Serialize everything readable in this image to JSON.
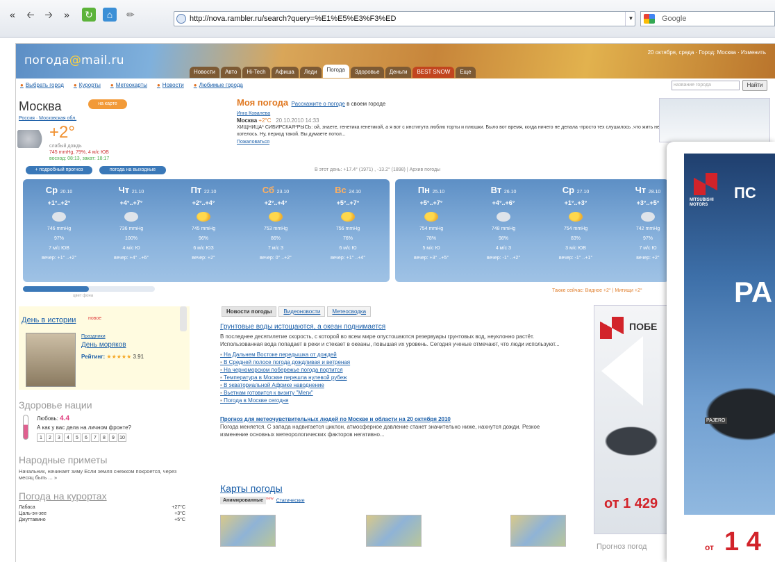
{
  "browser": {
    "url": "http://nova.rambler.ru/search?query=%E1%E5%E3%F3%ED",
    "search_placeholder": "Google"
  },
  "header": {
    "logo_text": "погода",
    "logo_at": "@",
    "logo_domain": "mail.ru",
    "top_right": "20 октября, среда · Город: Москва · Изменить",
    "tabs": [
      "Новости",
      "Авто",
      "Hi-Tech",
      "Афиша",
      "Леди",
      "Погода",
      "Здоровье",
      "Деньги",
      "BEST SNOW",
      "Еще"
    ],
    "active_tab": "Погода"
  },
  "subnav": [
    "Выбрать город",
    "Курорты",
    "Метеокарты",
    "Новости",
    "Любимые города"
  ],
  "city_search": {
    "placeholder": "название города",
    "button": "Найти"
  },
  "city": {
    "name": "Москва",
    "map_button": "на карте",
    "breadcrumb": "Россия · Московская обл.",
    "temp": "+2°",
    "desc1": "слабый дождь",
    "desc2": "745 mmHg, 79%, 4 м/с ЮВ",
    "desc3": "восход: 08:13, закат: 18:17"
  },
  "buttons": {
    "detailed": "+ подробный прогноз",
    "weekend": "погода на выходные"
  },
  "my_weather": {
    "title": "Моя погода",
    "invite": "Расскажите о погоде",
    "invite_rest": "в своем городе",
    "author": "Инга Ковалева",
    "author_temp": "+2°C",
    "place": "Москва",
    "datetime": "20.10.2010 14:33",
    "text": "ХИЩНИЦА* СИБИРСКАЯ*РЫСЬ: ой, знаете, генетика генетикой, а я вот с института люблю торты и плюшки. Было вот время, когда ничего не делала -просто тех слушилось ,что жить не хотелось. Ну, период такой. Вы думаете потол...",
    "complain": "Пожаловаться"
  },
  "today_line": "В этот день: +17.4° (1971) , -13.2° (1898) | Архив погоды",
  "forecast": [
    {
      "day": "Ср",
      "date": "20.10",
      "temp": "+1°..+2°",
      "icon": "cloud",
      "p": "746 mmHg",
      "h": "97%",
      "w": "7 м/с ЮВ",
      "e": "вечер: +1° ..+2°",
      "weekend": false
    },
    {
      "day": "Чт",
      "date": "21.10",
      "temp": "+4°..+7°",
      "icon": "cloud",
      "p": "736 mmHg",
      "h": "100%",
      "w": "4 м/с Ю",
      "e": "вечер: +4° ..+6°",
      "weekend": false
    },
    {
      "day": "Пт",
      "date": "22.10",
      "temp": "+2°..+4°",
      "icon": "sun",
      "p": "745 mmHg",
      "h": "96%",
      "w": "6 м/с ЮЗ",
      "e": "вечер: +2°",
      "weekend": false
    },
    {
      "day": "Сб",
      "date": "23.10",
      "temp": "+2°..+4°",
      "icon": "sun",
      "p": "753 mmHg",
      "h": "86%",
      "w": "7 м/с З",
      "e": "вечер: 0° ..+2°",
      "weekend": true
    },
    {
      "day": "Вс",
      "date": "24.10",
      "temp": "+5°..+7°",
      "icon": "sun",
      "p": "756 mmHg",
      "h": "76%",
      "w": "6 м/с Ю",
      "e": "вечер: +1° ..+4°",
      "weekend": true
    },
    {
      "day": "Пн",
      "date": "25.10",
      "temp": "+5°..+7°",
      "icon": "sun",
      "p": "754 mmHg",
      "h": "78%",
      "w": "5 м/с Ю",
      "e": "вечер: +3° ..+5°",
      "weekend": false
    },
    {
      "day": "Вт",
      "date": "26.10",
      "temp": "+4°..+6°",
      "icon": "cloud",
      "p": "748 mmHg",
      "h": "98%",
      "w": "4 м/с З",
      "e": "вечер: -1° ..+2°",
      "weekend": false
    },
    {
      "day": "Ср",
      "date": "27.10",
      "temp": "+1°..+3°",
      "icon": "sun",
      "p": "754 mmHg",
      "h": "83%",
      "w": "3 м/с ЮВ",
      "e": "вечер: -1° ..+1°",
      "weekend": false
    },
    {
      "day": "Чт",
      "date": "28.10",
      "temp": "+3°..+5°",
      "icon": "cloud",
      "p": "742 mmHg",
      "h": "97%",
      "w": "7 м/с Ю",
      "e": "вечер: +2°",
      "weekend": false
    }
  ],
  "forecast_scroll_label": "цвет фона",
  "forecast_scroll_fraction": 0.5,
  "now_line": "Также сейчас: Видное +2° | Митищи +2°",
  "history": {
    "title": "День в истории",
    "badge": "новое",
    "small_link": "Праздники",
    "link": "День моряков",
    "rating_label": "Рейтинг:",
    "stars": "★★★★★",
    "rating": "3.91"
  },
  "health": {
    "title": "Здоровье нации",
    "love_label": "Любовь:",
    "love_value": "4.4",
    "question": "А как у вас дела на личном фронте?",
    "scale": [
      "1",
      "2",
      "3",
      "4",
      "5",
      "6",
      "7",
      "8",
      "9",
      "10"
    ]
  },
  "omens": {
    "title": "Народные приметы",
    "text": "Начальник, начинает зиму Если земля снежком покроется, через месяц быть ... »"
  },
  "resorts": {
    "title": "Погода на курортах",
    "items": [
      {
        "n": "Лабаса",
        "t": "+27°C"
      },
      {
        "n": "Цаль-эн-зее",
        "t": "+3°C"
      },
      {
        "n": "Джуттавино",
        "t": "+5°C"
      }
    ]
  },
  "news_tabs": [
    "Новости погоды",
    "Видеоновости",
    "Метеосводка"
  ],
  "news": {
    "headline": "Грунтовые воды истощаются, а океан поднимается",
    "lead": "В последнее десятилетие скорость, с которой во всем мире опустошаются резервуары грунтовых вод, неуклонно растёт. Использованная вода попадает в реки и стекает в океаны, повышая их уровень. Сегодня ученые отмечают, что люди используют...",
    "items": [
      "На Дальнем Востоке передышка от дождей",
      "В Средней полосе погода дождливая и ветреная",
      "На черноморском побережье погода портится",
      "Температура в Москве перешла нулевой рубеж",
      "В экваториальной Африке наводнение",
      "Вьетнам готовится к визиту \"Меги\"",
      "Погода в Москве сегодня"
    ],
    "forecast_title": "Прогноз для метеочувствительных людей по Москве и области на 20 октября 2010",
    "forecast_text": "Погода меняется. С запада надвигается циклон, атмосферное давление станет значительно ниже, нахнутся дожди. Резкое изменение основных метеорологических факторов негативно..."
  },
  "maps": {
    "title": "Карты погоды",
    "tab_anim": "Анимированные",
    "new_badge": "new",
    "tab_static": "Статические"
  },
  "ad_small": {
    "text": "ПОБЕ",
    "price": "от 1 429",
    "brand": "MITSUBISHI MOTORS"
  },
  "ad_overlay": {
    "head": "ПС",
    "big": "PA",
    "price_prefix": "от",
    "price": "1 4",
    "model": "PAJERO"
  },
  "forecast_link": "Прогноз погод"
}
